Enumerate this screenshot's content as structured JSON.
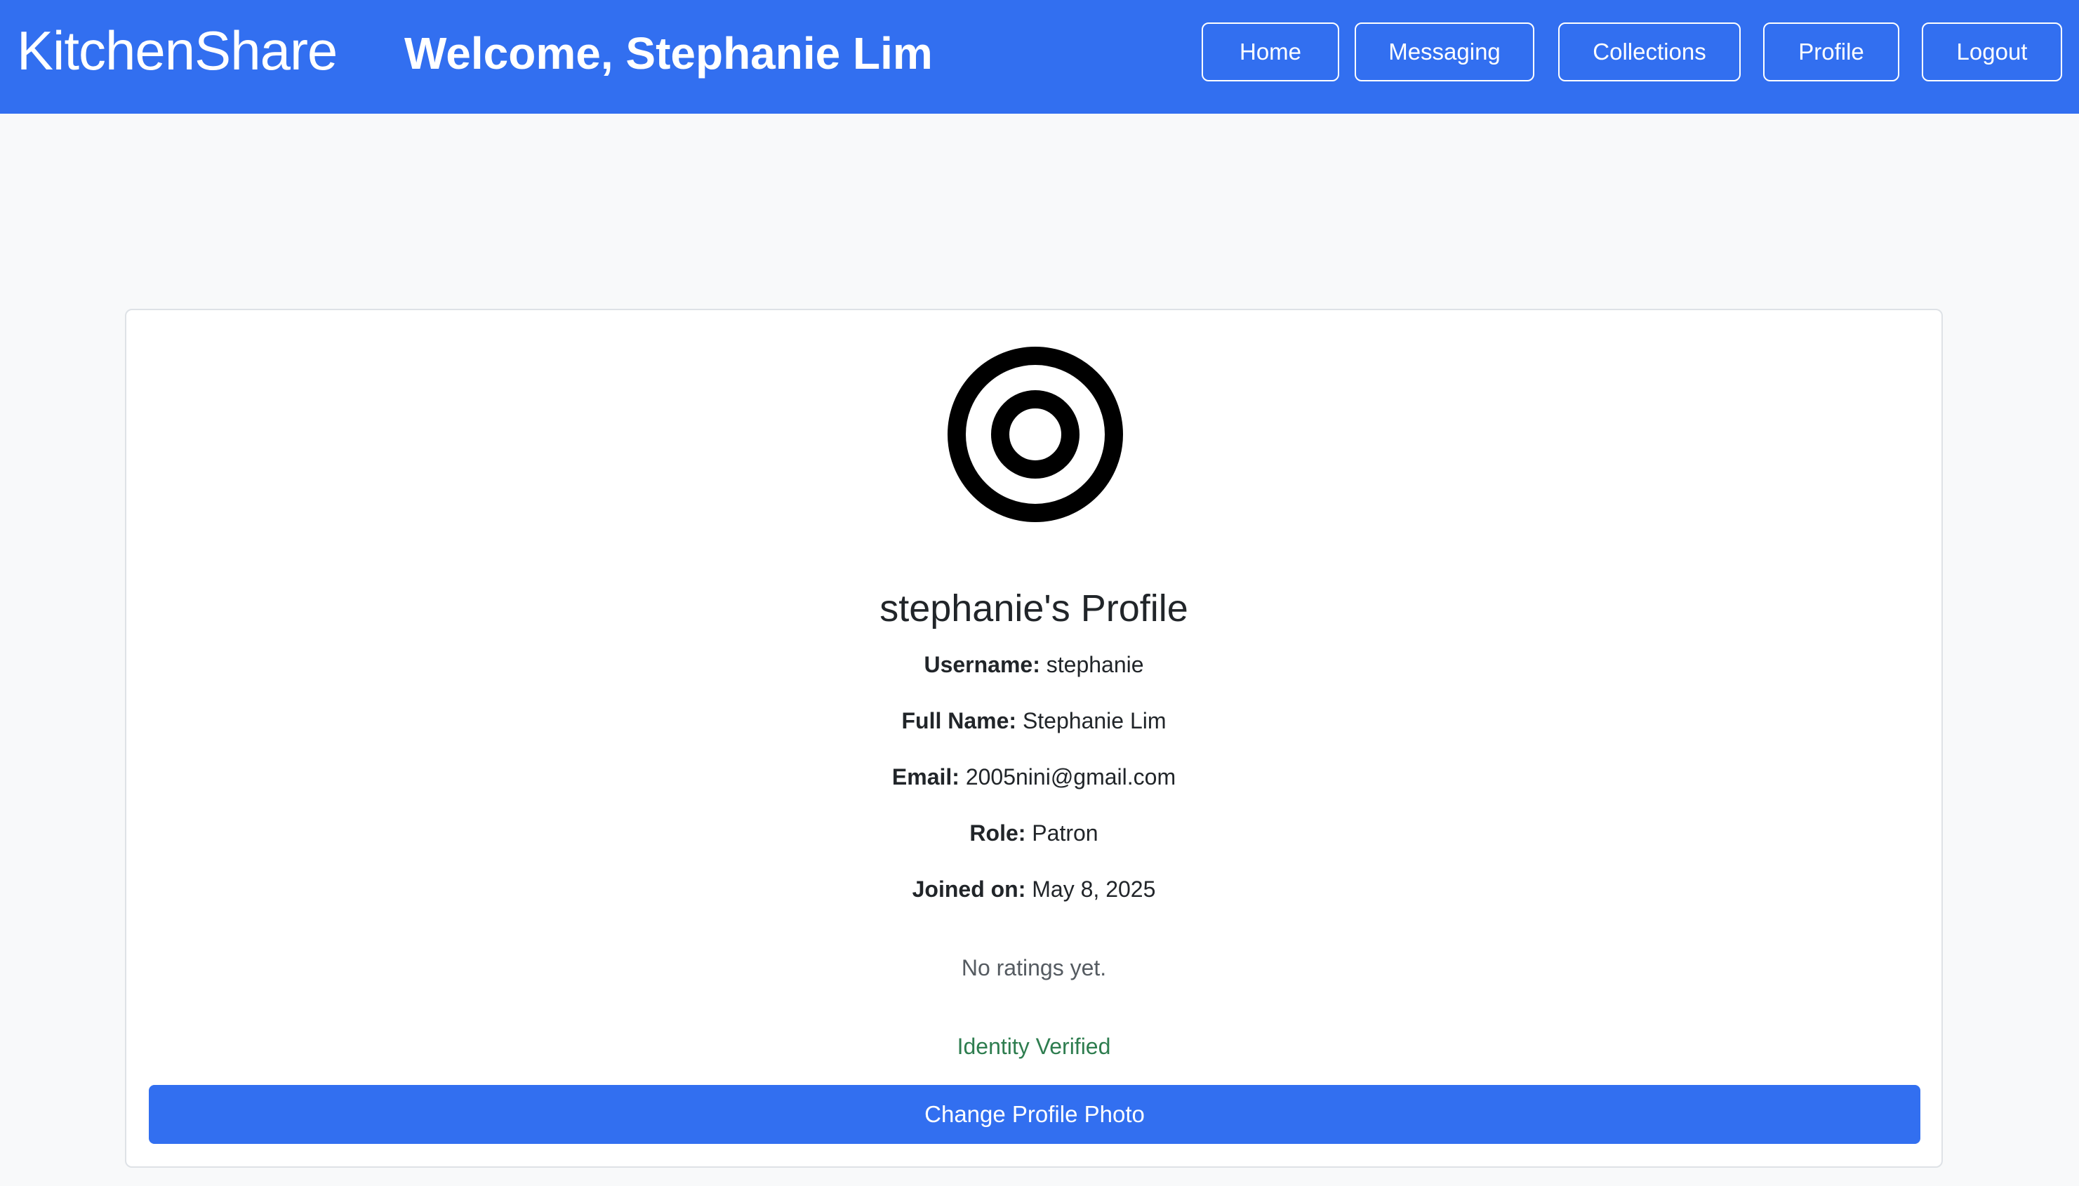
{
  "colors": {
    "brand_blue": "#326ff0",
    "background": "#f8f9fa",
    "card": "#ffffff",
    "verified_green": "#2e7d4f"
  },
  "navbar": {
    "brand": "KitchenShare",
    "welcome": "Welcome, Stephanie Lim",
    "buttons": {
      "home": "Home",
      "messaging": "Messaging",
      "collections": "Collections",
      "profile": "Profile",
      "logout": "Logout"
    }
  },
  "profile": {
    "avatar_icon": "target-circle-icon",
    "title": "stephanie's Profile",
    "fields": [
      {
        "label": "Username:",
        "value": "stephanie"
      },
      {
        "label": "Full Name:",
        "value": "Stephanie Lim"
      },
      {
        "label": "Email:",
        "value": "2005nini@gmail.com"
      },
      {
        "label": "Role:",
        "value": "Patron"
      },
      {
        "label": "Joined on:",
        "value": "May 8, 2025"
      }
    ],
    "ratings_text": "No ratings yet.",
    "verification_text": "Identity Verified",
    "change_photo_button": "Change Profile Photo"
  }
}
